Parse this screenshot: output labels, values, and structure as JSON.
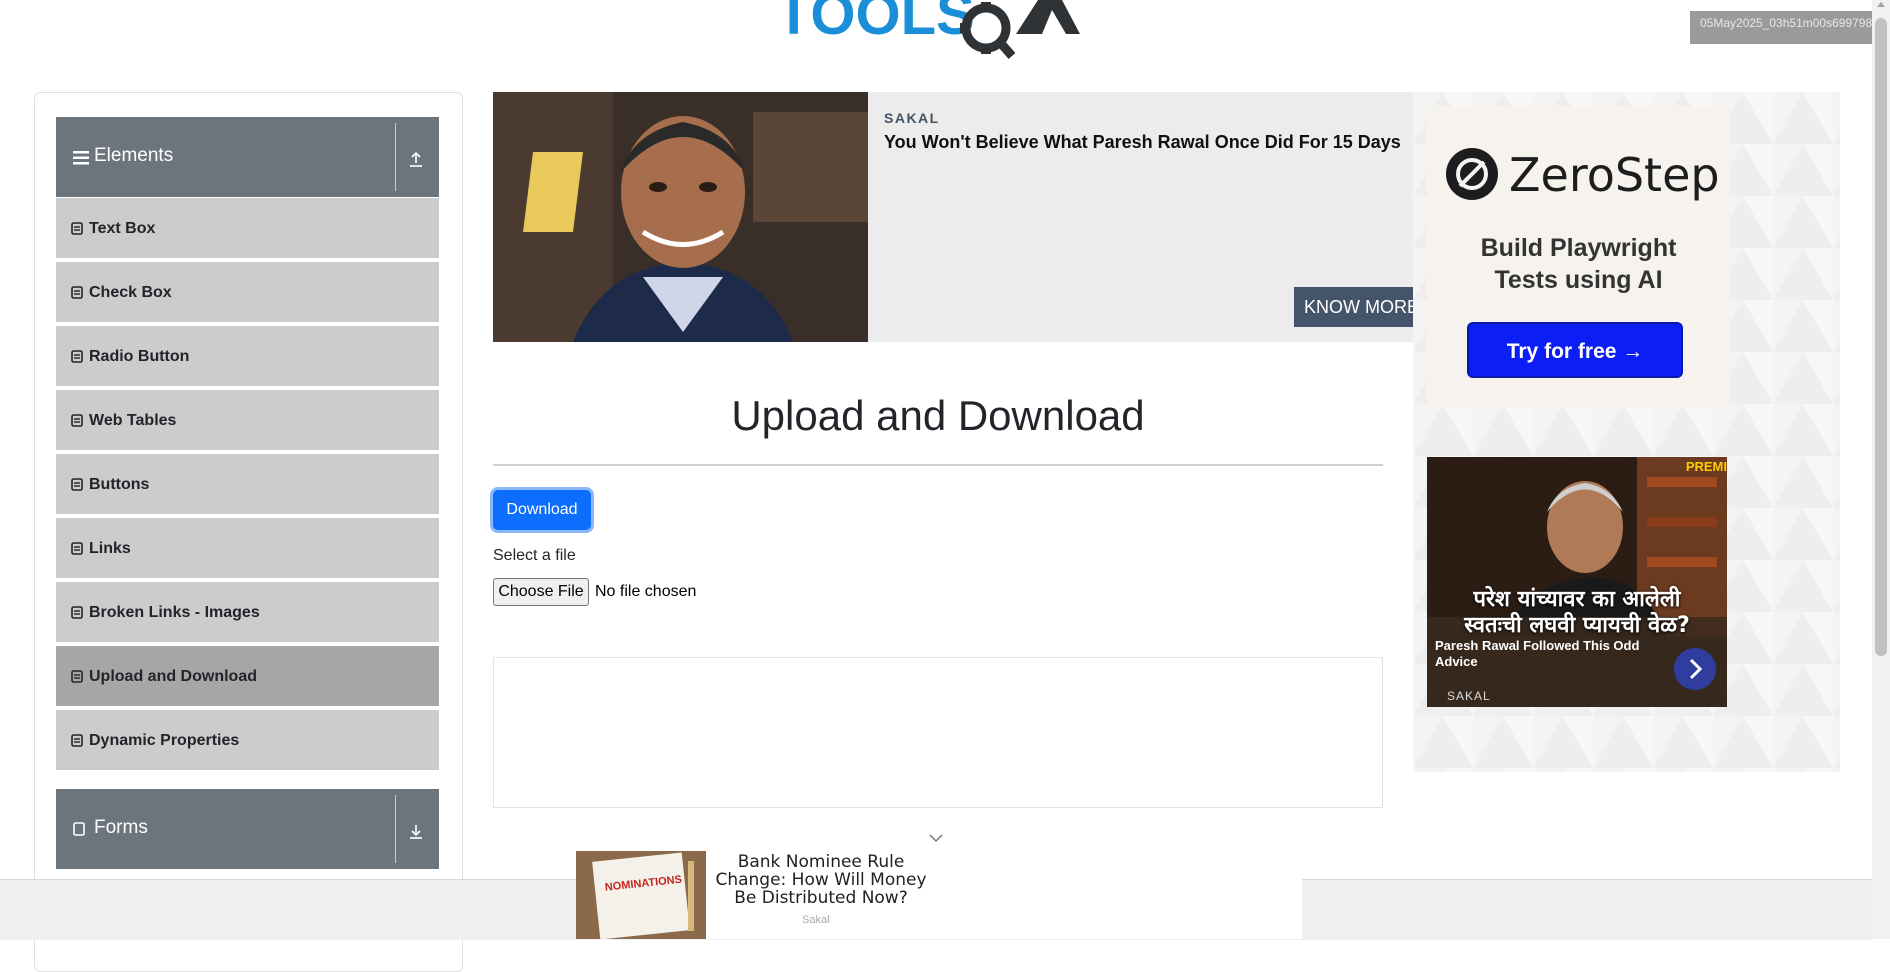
{
  "header": {
    "logo_text": "TOOLSQA",
    "timestamp": "05May2025_03h51m00s699798"
  },
  "sidebar": {
    "groups": [
      {
        "label": "Elements",
        "expanded": true
      },
      {
        "label": "Forms",
        "expanded": false
      }
    ],
    "items": [
      {
        "label": "Text Box"
      },
      {
        "label": "Check Box"
      },
      {
        "label": "Radio Button"
      },
      {
        "label": "Web Tables"
      },
      {
        "label": "Buttons"
      },
      {
        "label": "Links"
      },
      {
        "label": "Broken Links - Images"
      },
      {
        "label": "Upload and Download",
        "active": true
      },
      {
        "label": "Dynamic Properties"
      }
    ]
  },
  "ad_banner": {
    "source": "SAKAL",
    "headline": "You Won't Believe What Paresh Rawal Once Did For 15 Days",
    "cta": "KNOW MORE"
  },
  "main": {
    "title": "Upload and Download",
    "download_label": "Download",
    "select_label": "Select a file",
    "file_button_label": "Choose File",
    "file_status": "No file chosen"
  },
  "right_ads": {
    "zerostep": {
      "brand": "ZeroStep",
      "tagline_line1": "Build Playwright",
      "tagline_line2": "Tests using AI",
      "cta": "Try for free →"
    },
    "video_ad": {
      "overlay_line1": "परेश यांच्यावर का आलेली",
      "overlay_line2": "स्वतःची लघवी प्यायची वेळ?",
      "caption": "Paresh Rawal Followed This Odd Advice",
      "source": "SAKAL",
      "badge": "PREMI"
    }
  },
  "bottom_ad": {
    "headline": "Bank Nominee Rule Change: How Will Money Be Distributed Now?",
    "source": "Sakal",
    "thumb_text": "NOMINATIONS"
  },
  "colors": {
    "sidebar_header": "#6c757d",
    "menu_item": "#cccccc",
    "menu_item_active": "#a6a6a6",
    "primary_button": "#0d6efd",
    "logo_blue": "#1a8fd8",
    "logo_dark": "#303336",
    "zerostep_cta": "#0a1ef5"
  }
}
